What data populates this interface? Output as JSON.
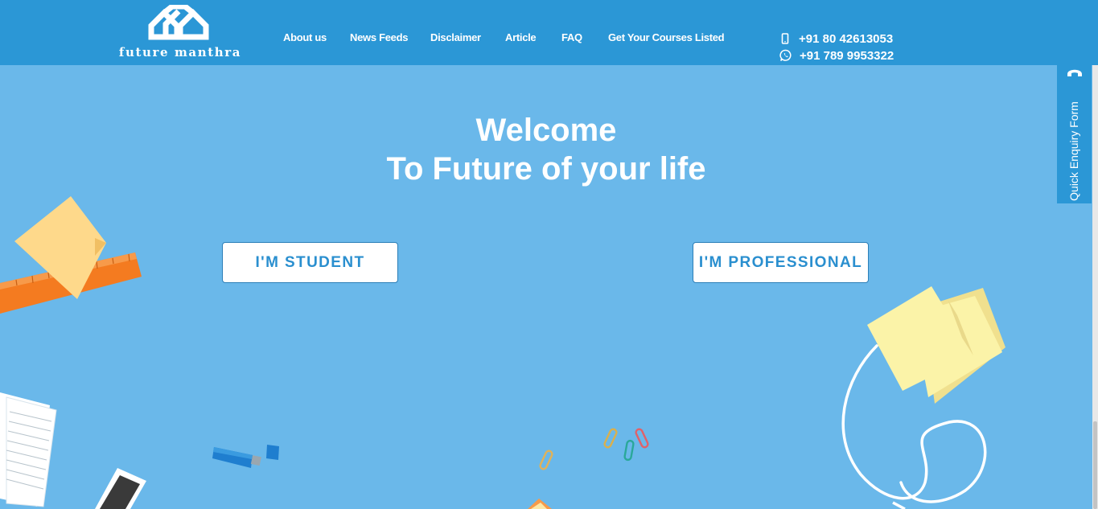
{
  "brand": {
    "name": "future manthra"
  },
  "nav": {
    "items": [
      {
        "label": "About us"
      },
      {
        "label": "News Feeds"
      },
      {
        "label": "Disclaimer"
      },
      {
        "label": "Article"
      },
      {
        "label": "FAQ"
      },
      {
        "label": "Get Your Courses Listed"
      }
    ]
  },
  "contact": {
    "phone": "+91 80 42613053",
    "whatsapp": "+91 789 9953322"
  },
  "hero": {
    "title_line1": "Welcome",
    "title_line2": "To Future of your life",
    "student_button": "I'M STUDENT",
    "professional_button": "I'M PROFESSIONAL"
  },
  "enquiry": {
    "label": "Quick Enquiry Form",
    "icon": "phone-icon"
  },
  "colors": {
    "header": "#2b97d6",
    "background": "#6ab8ea",
    "button_text": "#2a8fcf",
    "sticky_note": "#fbf3a8",
    "ruler": "#f47b20"
  }
}
